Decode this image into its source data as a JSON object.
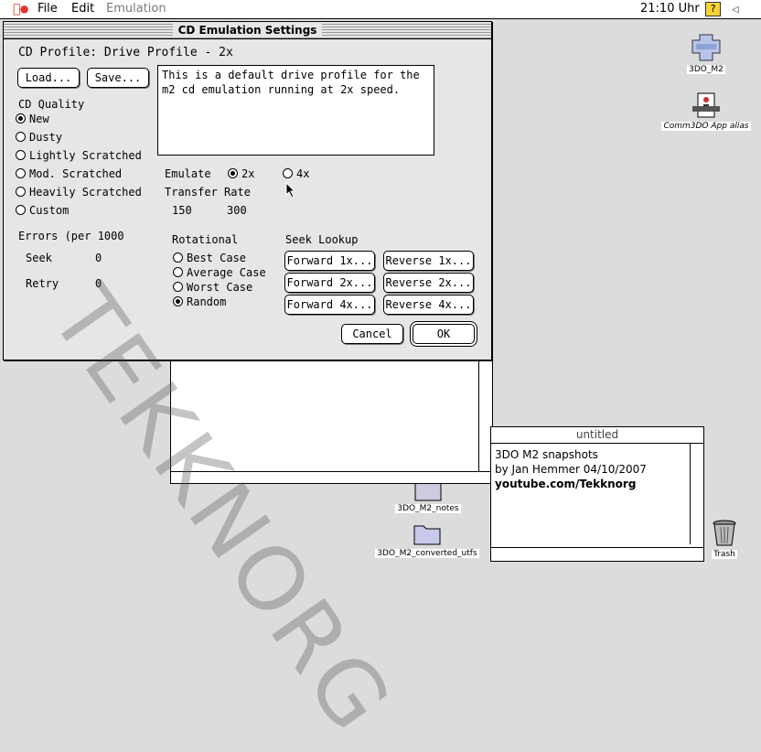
{
  "menubar": {
    "items": [
      "File",
      "Edit",
      "Emulation"
    ],
    "clock": "21:10 Uhr"
  },
  "desktop": {
    "icons": [
      {
        "label": "3DO_M2",
        "icon": "3do-m2-icon"
      },
      {
        "label": "Comm3DO App alias",
        "icon": "comm3do-app-icon"
      },
      {
        "label": "3DO_M2_notes",
        "icon": "document-icon"
      },
      {
        "label": "3DO_M2_converted_utfs",
        "icon": "folder-icon"
      },
      {
        "label": "Trash",
        "icon": "trash-icon"
      }
    ]
  },
  "note": {
    "title": "untitled",
    "lines": [
      "3DO M2 snapshots",
      "by Jan Hemmer 04/10/2007",
      "youtube.com/Tekknorg"
    ]
  },
  "dialog": {
    "title": "CD Emulation Settings",
    "profile_label": "CD Profile: Drive Profile - 2x",
    "load_button": "Load...",
    "save_button": "Save...",
    "description": "This is a default drive profile for the m2 cd emulation running at 2x speed.",
    "quality": {
      "heading": "CD Quality",
      "options": [
        "New",
        "Dusty",
        "Lightly Scratched",
        "Mod. Scratched",
        "Heavily Scratched",
        "Custom"
      ],
      "selected": "New"
    },
    "emulate": {
      "label": "Emulate",
      "options": [
        "2x",
        "4x"
      ],
      "selected": "2x"
    },
    "transfer": {
      "label": "Transfer Rate",
      "values": [
        "150",
        "300"
      ]
    },
    "errors": {
      "heading": "Errors (per 1000",
      "seek_label": "Seek",
      "seek_value": "0",
      "retry_label": "Retry",
      "retry_value": "0"
    },
    "rotational": {
      "heading": "Rotational",
      "options": [
        "Best Case",
        "Average Case",
        "Worst Case",
        "Random"
      ],
      "selected": "Random"
    },
    "seek_lookup": {
      "heading": "Seek Lookup",
      "forward": [
        "Forward 1x...",
        "Forward 2x...",
        "Forward 4x..."
      ],
      "reverse": [
        "Reverse 1x...",
        "Reverse 2x...",
        "Reverse 4x..."
      ]
    },
    "cancel_button": "Cancel",
    "ok_button": "OK"
  },
  "watermark": "TEKKNORG",
  "colors": {
    "dialog_bg": "#e6e6e6",
    "desktop_bg": "#dcdcdc",
    "apple": "#e0342c",
    "help": "#f7d23b"
  }
}
